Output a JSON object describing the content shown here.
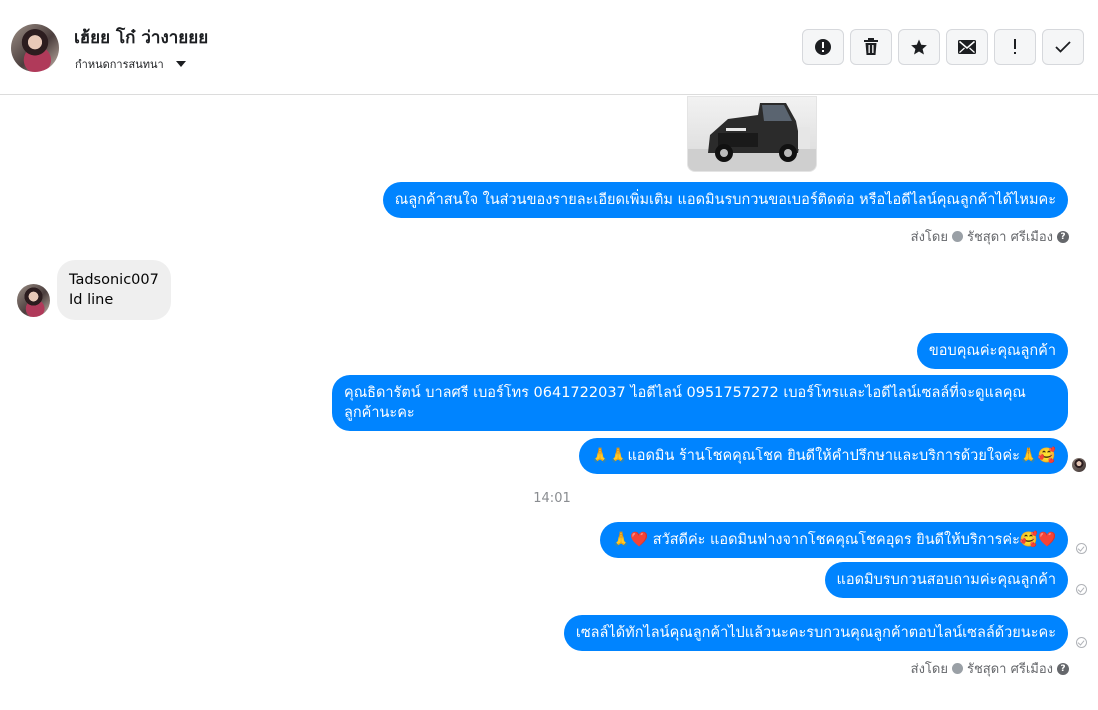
{
  "header": {
    "contact_name": "เฮ้ยย โก๋ ว่างายยย",
    "assign_label": "กำหนดการสนทนา"
  },
  "actions": [
    {
      "name": "spam-report-button",
      "icon": "alert-circle-icon"
    },
    {
      "name": "delete-button",
      "icon": "trash-icon"
    },
    {
      "name": "star-button",
      "icon": "star-icon"
    },
    {
      "name": "mark-unread-button",
      "icon": "envelope-icon"
    },
    {
      "name": "follow-up-button",
      "icon": "exclamation-icon"
    },
    {
      "name": "mark-done-button",
      "icon": "check-icon"
    }
  ],
  "messages": {
    "m1": "ณลูกค้าสนใจ ในส่วนของรายละเอียดเพิ่มเติม แอดมินรบกวนขอเบอร์ติดต่อ หรือไอดีไลน์คุณลูกค้าได้ไหมคะ",
    "incoming_line1": "Tadsonic007",
    "incoming_line2": "Id line",
    "m2": "ขอบคุณค่ะคุณลูกค้า",
    "m3": "คุณธิดารัตน์ บาลศรี เบอร์โทร 0641722037  ไอดีไลน์ 0951757272   เบอร์โทรและไอดีไลน์เซลล์ที่จะดูแลคุณลูกค้านะคะ",
    "m4": "🙏🙏แอดมิน ร้านโชคคุณโชค ยินดีให้คำปรึกษาและบริการด้วยใจค่ะ🙏🥰",
    "time": "14:01",
    "m5": "🙏❤️ สวัสดีค่ะ แอดมินฟางจากโชคคุณโชคอุดร ยินดีให้บริการค่ะ🥰❤️",
    "m6": "แอดมิบรบกวนสอบถามค่ะคุณลูกค้า",
    "m7": "เซลล์ได้ทักไลน์คุณลูกค้าไปแล้วนะคะรบกวนคุณลูกค้าตอบไลน์เซลล์ด้วยนะคะ"
  },
  "sent_by": {
    "prefix": "ส่งโดย",
    "agent": "รัชสุดา ศรีเมือง"
  }
}
